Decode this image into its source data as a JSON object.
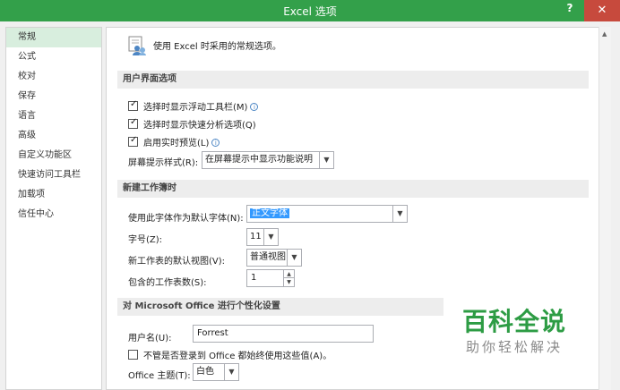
{
  "window": {
    "title": "Excel 选项",
    "help": "?",
    "close": "✕"
  },
  "sidebar": {
    "items": [
      {
        "label": "常规",
        "selected": true
      },
      {
        "label": "公式"
      },
      {
        "label": "校对"
      },
      {
        "label": "保存"
      },
      {
        "label": "语言"
      },
      {
        "label": "高级"
      },
      {
        "label": "自定义功能区"
      },
      {
        "label": "快速访问工具栏"
      },
      {
        "label": "加载项"
      },
      {
        "label": "信任中心"
      }
    ]
  },
  "main": {
    "intro": "使用 Excel 时采用的常规选项。",
    "ui_section": {
      "header": "用户界面选项",
      "cb_minitoolbar": "选择时显示浮动工具栏(M)",
      "cb_quickanalysis": "选择时显示快速分析选项(Q)",
      "cb_livepreview": "启用实时预览(L)",
      "screentip_label": "屏幕提示样式(R):",
      "screentip_value": "在屏幕提示中显示功能说明"
    },
    "new_wb_section": {
      "header": "新建工作簿时",
      "font_label": "使用此字体作为默认字体(N):",
      "font_value": "正文字体",
      "size_label": "字号(Z):",
      "size_value": "11",
      "view_label": "新工作表的默认视图(V):",
      "view_value": "普通视图",
      "sheets_label": "包含的工作表数(S):",
      "sheets_value": "1"
    },
    "personalize_section": {
      "header": "对 Microsoft Office 进行个性化设置",
      "username_label": "用户名(U):",
      "username_value": "Forrest",
      "always_use_label": "不管是否登录到 Office 都始终使用这些值(A)。",
      "theme_label": "Office 主题(T):",
      "theme_value": "白色"
    }
  },
  "watermark": {
    "main": "百科全说",
    "sub": "助你轻松解决"
  },
  "colors": {
    "titlebar": "#33a04a",
    "close": "#c74a3d",
    "selection": "#3399ff",
    "nav_selected": "#d8eede",
    "watermark": "#2d9c44"
  }
}
